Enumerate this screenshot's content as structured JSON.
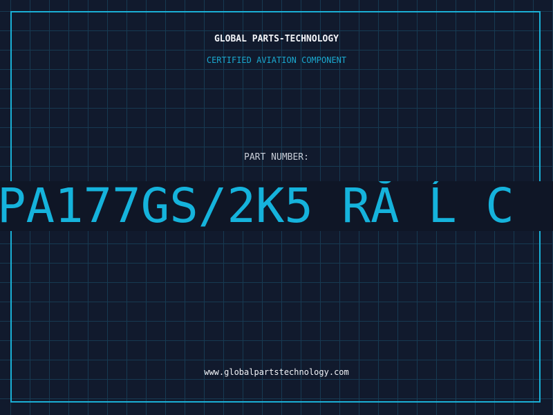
{
  "header": {
    "brand": "GLOBAL PARTS-TECHNOLOGY",
    "subtitle": "CERTIFIED AVIATION COMPONENT"
  },
  "part": {
    "label": "PART NUMBER:",
    "value": "PA177GS/2K5_RĂ Ĺ C"
  },
  "footer": {
    "website": "www.globalpartstechnology.com"
  },
  "colors": {
    "background": "#111a2d",
    "grid": "#173a52",
    "accent": "#15b3dc",
    "text": "#f2f4f8"
  }
}
